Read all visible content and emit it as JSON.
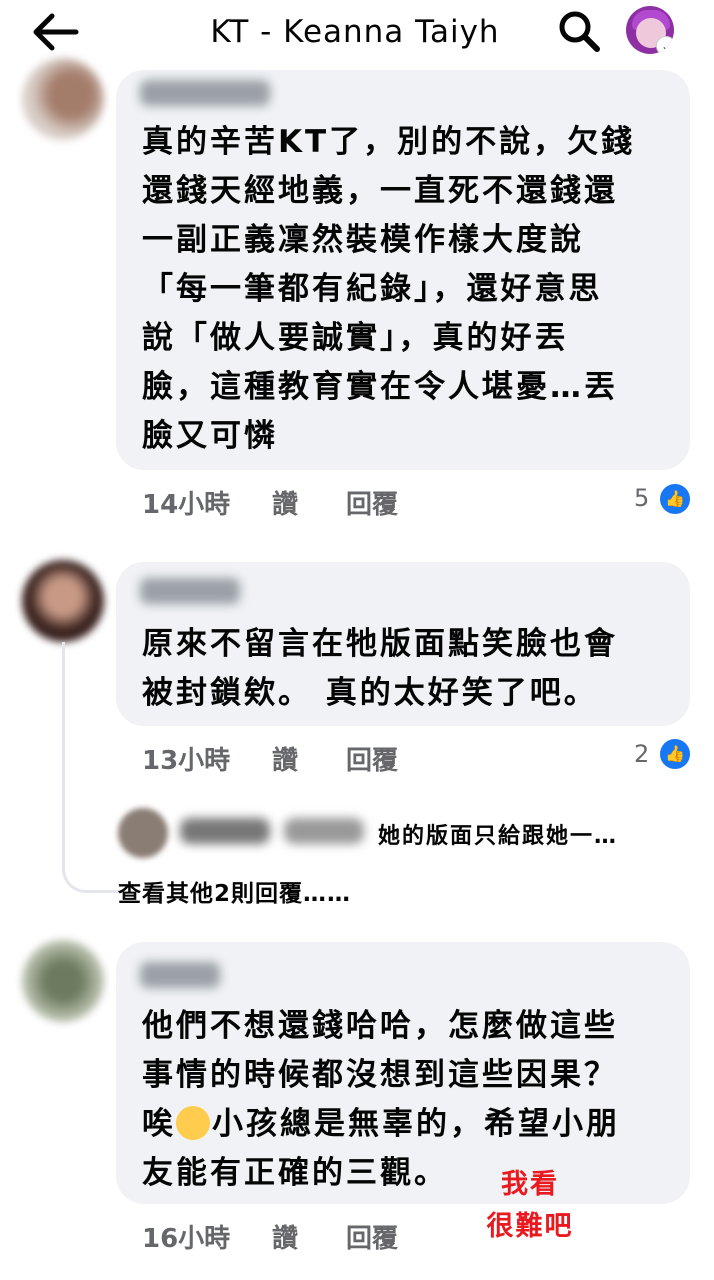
{
  "header": {
    "title": "KT - Keanna Taiyh"
  },
  "comments": [
    {
      "text": "真的辛苦KT了，別的不說，欠錢\n還錢天經地義，一直死不還錢還\n一副正義凜然裝模作樣大度說\n「每一筆都有紀錄」，還好意思\n說「做人要誠實」，真的好丟\n臉，這種教育實在令人堪憂…丟\n臉又可憐",
      "time": "14小時",
      "like_label": "讚",
      "reply_label": "回覆",
      "likes": "5"
    },
    {
      "text": "原來不留言在牠版面點笑臉也會\n被封鎖欸。 真的太好笑了吧。",
      "time": "13小時",
      "like_label": "讚",
      "reply_label": "回覆",
      "likes": "2",
      "reply_preview": "她的版面只給跟她一…",
      "more_replies": "查看其他2則回覆……"
    },
    {
      "text_line1": "他們不想還錢哈哈，怎麼做這些",
      "text_line2": "事情的時候都沒想到這些因果？",
      "text_line3_after_emoji": "小孩總是無辜的，希望小朋",
      "text_line3_before_emoji": "唉",
      "text_line4": "友能有正確的三觀。",
      "time": "16小時",
      "like_label": "讚",
      "reply_label": "回覆"
    }
  ],
  "annotation": {
    "line1": "我看",
    "line2": "很難吧",
    "color": "#e8191f"
  },
  "icons": [
    "back-arrow-icon",
    "search-icon",
    "profile-avatar",
    "like-thumb-icon",
    "blushing-emoji"
  ]
}
